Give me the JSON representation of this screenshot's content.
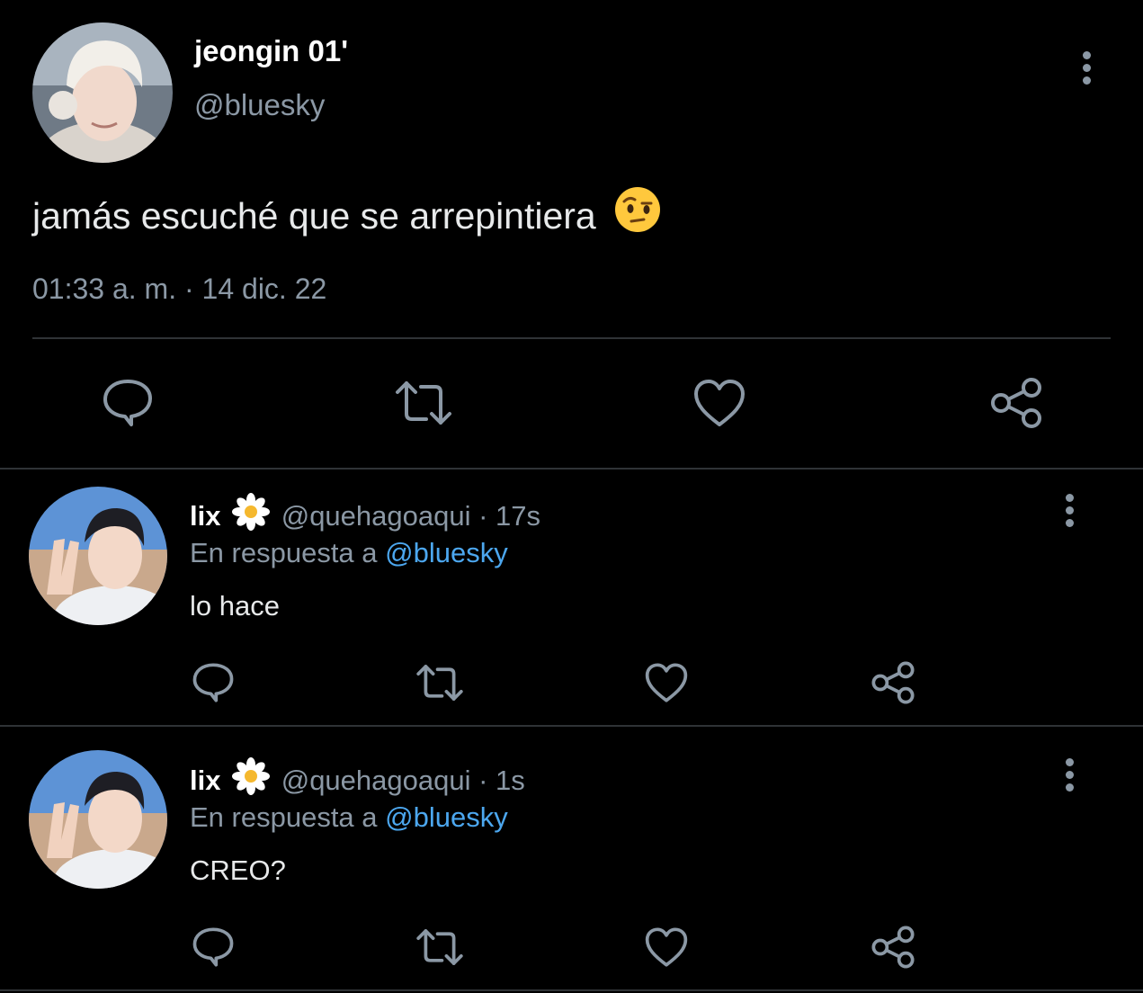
{
  "main_tweet": {
    "display_name": "jeongin 01'",
    "handle": "@bluesky",
    "text": "jamás escuché que se arrepintiera",
    "emoji": "🤨",
    "timestamp": "01:33 a. m. · 14 dic. 22"
  },
  "replies": [
    {
      "display_name": "lix",
      "name_emoji": "flower-icon",
      "handle": "@quehagoaqui",
      "time": "· 17s",
      "reply_prefix": "En respuesta a",
      "reply_to": "@bluesky",
      "text": "lo hace"
    },
    {
      "display_name": "lix",
      "name_emoji": "flower-icon",
      "handle": "@quehagoaqui",
      "time": "· 1s",
      "reply_prefix": "En respuesta a",
      "reply_to": "@bluesky",
      "text": "CREO?"
    }
  ],
  "colors": {
    "background": "#000000",
    "text": "#e7e9ea",
    "muted": "#8b98a5",
    "link": "#4ca7ef",
    "divider": "#2f3336"
  },
  "icons": [
    "comment-icon",
    "retweet-icon",
    "like-icon",
    "share-icon",
    "more-options-icon"
  ]
}
